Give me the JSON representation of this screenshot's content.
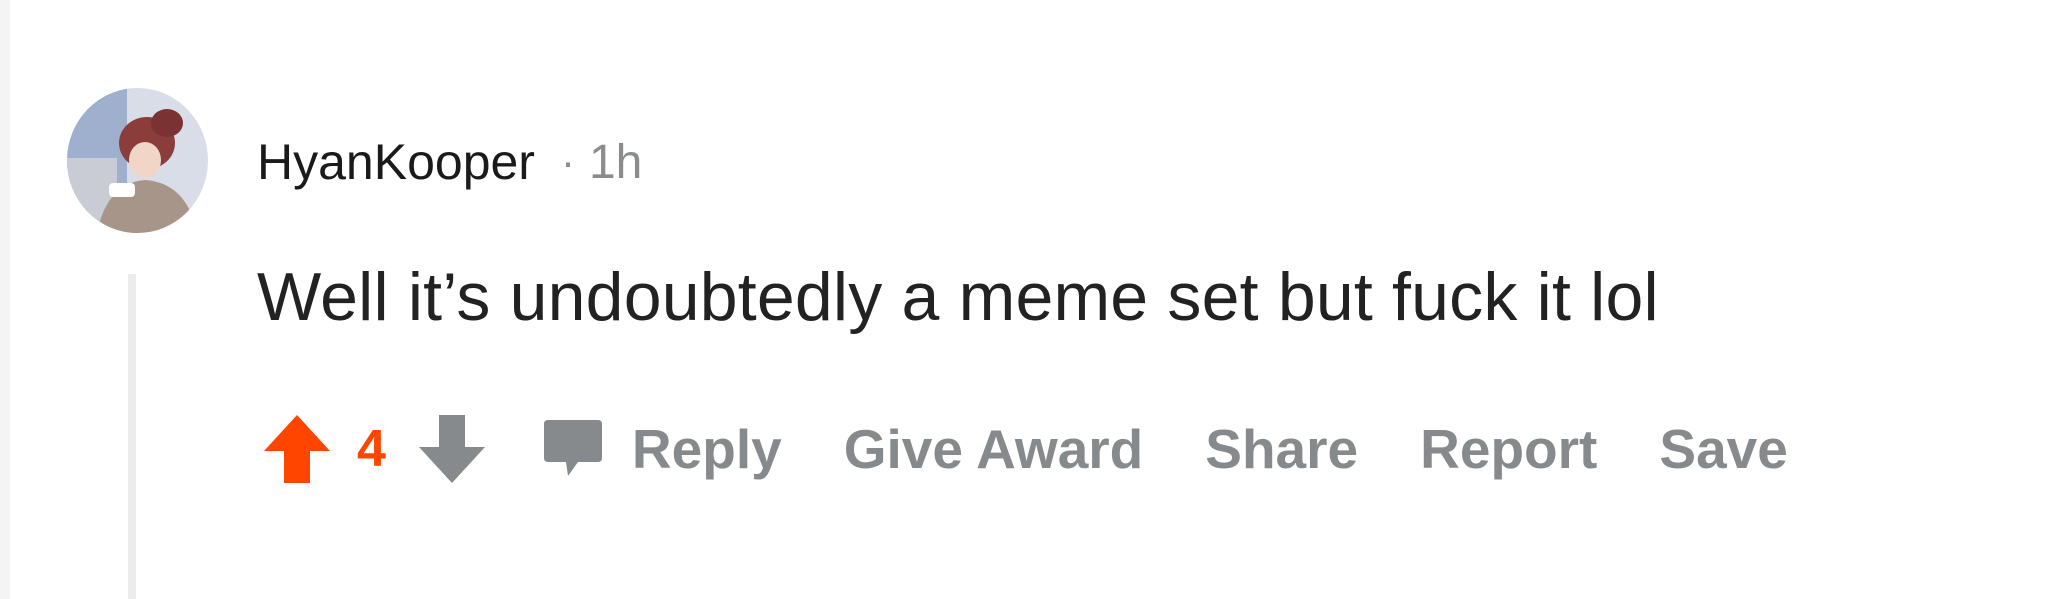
{
  "comment": {
    "username": "HyanKooper",
    "separator": "·",
    "timestamp": "1h",
    "body": "Well it’s undoubtedly a meme set but fuck it lol",
    "score": "4",
    "upvoted": true
  },
  "actions": {
    "reply": "Reply",
    "give_award": "Give Award",
    "share": "Share",
    "report": "Report",
    "save": "Save"
  },
  "icons": {
    "avatar": "user-avatar",
    "upvote": "upvote-arrow-icon",
    "downvote": "downvote-arrow-icon",
    "reply": "comment-bubble-icon"
  },
  "colors": {
    "upvote_active": "#ff4500",
    "muted": "#878a8c",
    "text": "#1a1a1b",
    "thread_line": "#ececec"
  }
}
